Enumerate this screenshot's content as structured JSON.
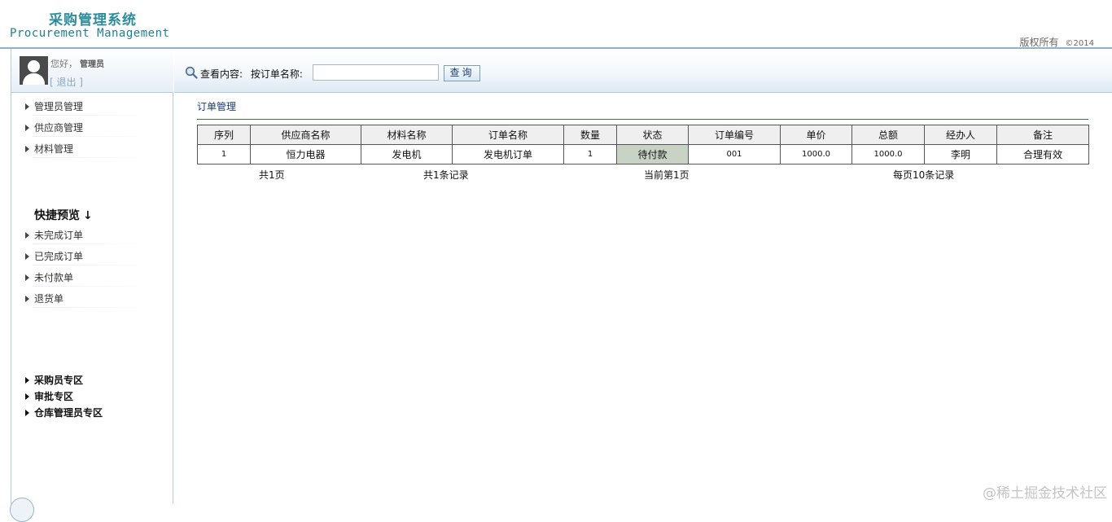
{
  "header": {
    "title_cn": "采购管理系统",
    "title_en": "Procurement Management",
    "copyright": "版权所有",
    "year": "©2014"
  },
  "user": {
    "greeting": "您好，",
    "name": "管理员",
    "logout": "[ 退出 ]"
  },
  "sidebar": {
    "main_items": [
      {
        "label": "管理员管理"
      },
      {
        "label": "供应商管理"
      },
      {
        "label": "材料管理"
      }
    ],
    "quick_title": "快捷预览",
    "quick_arrow": "↓",
    "quick_items": [
      {
        "label": "未完成订单"
      },
      {
        "label": "已完成订单"
      },
      {
        "label": "未付款单"
      },
      {
        "label": "退货单"
      }
    ],
    "zone_items": [
      {
        "label": "采购员专区"
      },
      {
        "label": "审批专区"
      },
      {
        "label": "仓库管理员专区"
      }
    ]
  },
  "search": {
    "label_view": "查看内容:",
    "label_field": "按订单名称:",
    "value": "",
    "button": "查询"
  },
  "main": {
    "section_title": "订单管理",
    "columns": [
      "序列",
      "供应商名称",
      "材料名称",
      "订单名称",
      "数量",
      "状态",
      "订单编号",
      "单价",
      "总额",
      "经办人",
      "备注"
    ],
    "rows": [
      [
        "1",
        "恒力电器",
        "发电机",
        "发电机订单",
        "1",
        "待付款",
        "001",
        "1000.0",
        "1000.0",
        "李明",
        "合理有效"
      ]
    ],
    "pager": {
      "total_pages": "共1页",
      "total_records": "共1条记录",
      "current_page": "当前第1页",
      "per_page": "每页10条记录"
    }
  },
  "watermark": "@稀土掘金技术社区",
  "colors": {
    "brand": "#2e8b9a",
    "border": "#b6cde0",
    "status_bg": "#c8d3c6",
    "section_title": "#1a3a7a"
  }
}
